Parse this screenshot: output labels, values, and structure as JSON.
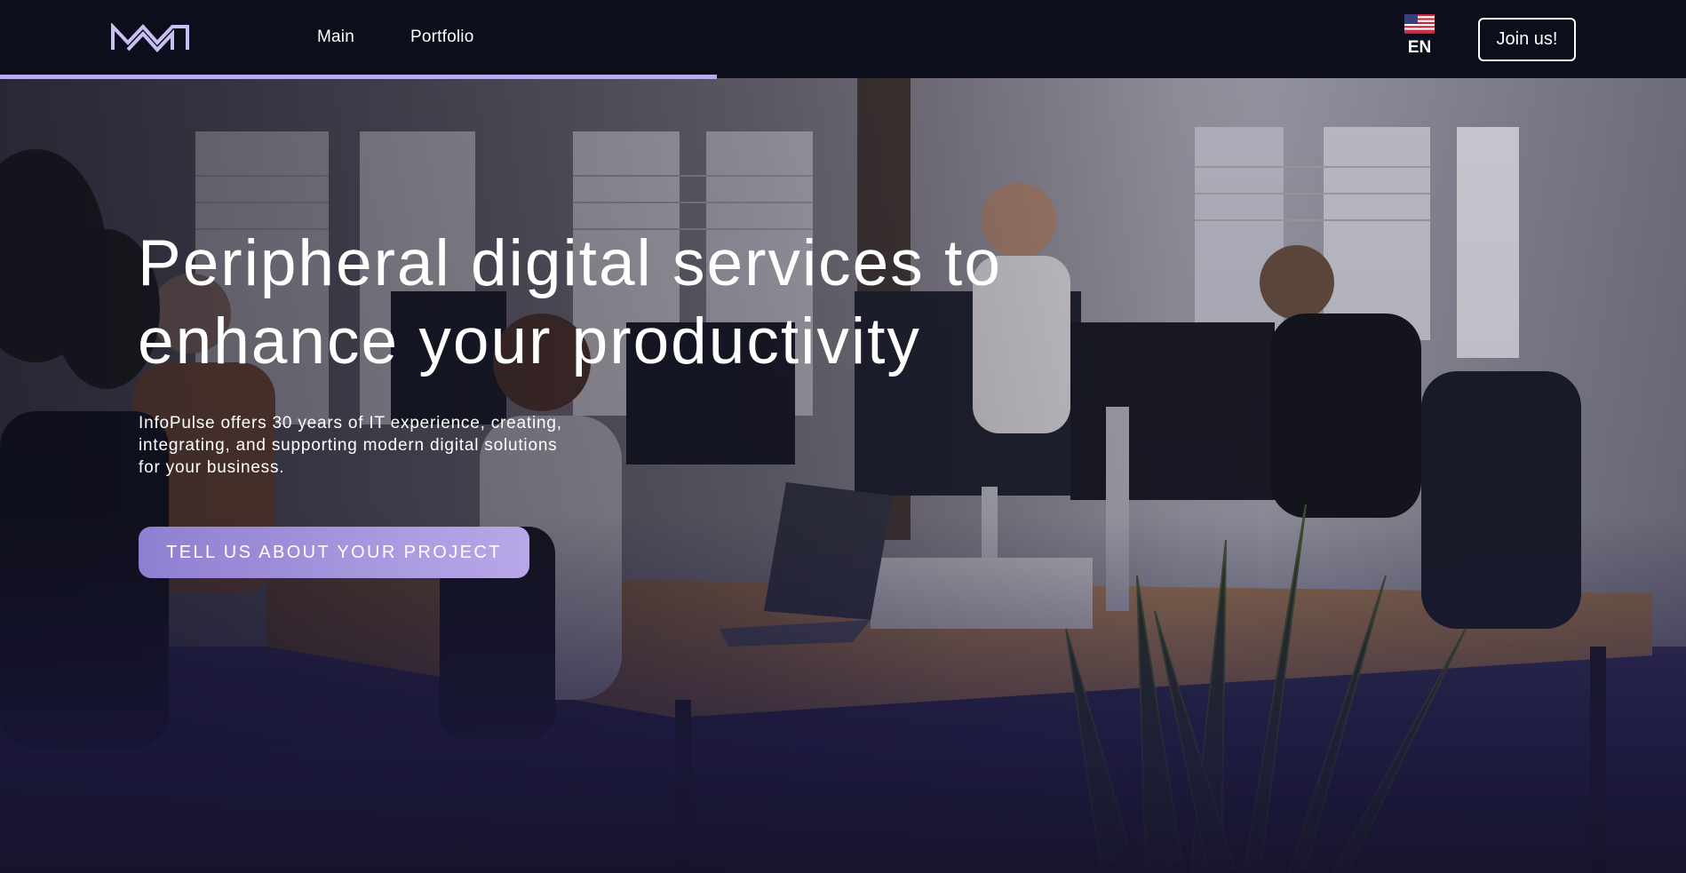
{
  "header": {
    "logo_text": "MW",
    "nav": [
      {
        "label": "Main"
      },
      {
        "label": "Portfolio"
      }
    ],
    "language": {
      "code": "EN",
      "flag_icon": "us-flag-icon"
    },
    "join_label": "Join us!",
    "scroll_progress": 0.425
  },
  "hero": {
    "headline": "Peripheral digital services to enhance your productivity",
    "subtext": "InfoPulse offers 30 years of IT experience, creating, integrating, and supporting modern digital solutions for your business.",
    "cta_label": "TELL US ABOUT YOUR PROJECT"
  },
  "colors": {
    "header_bg": "#0d0e1c",
    "accent": "#b9abee",
    "cta_gradient_start": "#8f7fd0",
    "cta_gradient_end": "#b8a8e8"
  }
}
